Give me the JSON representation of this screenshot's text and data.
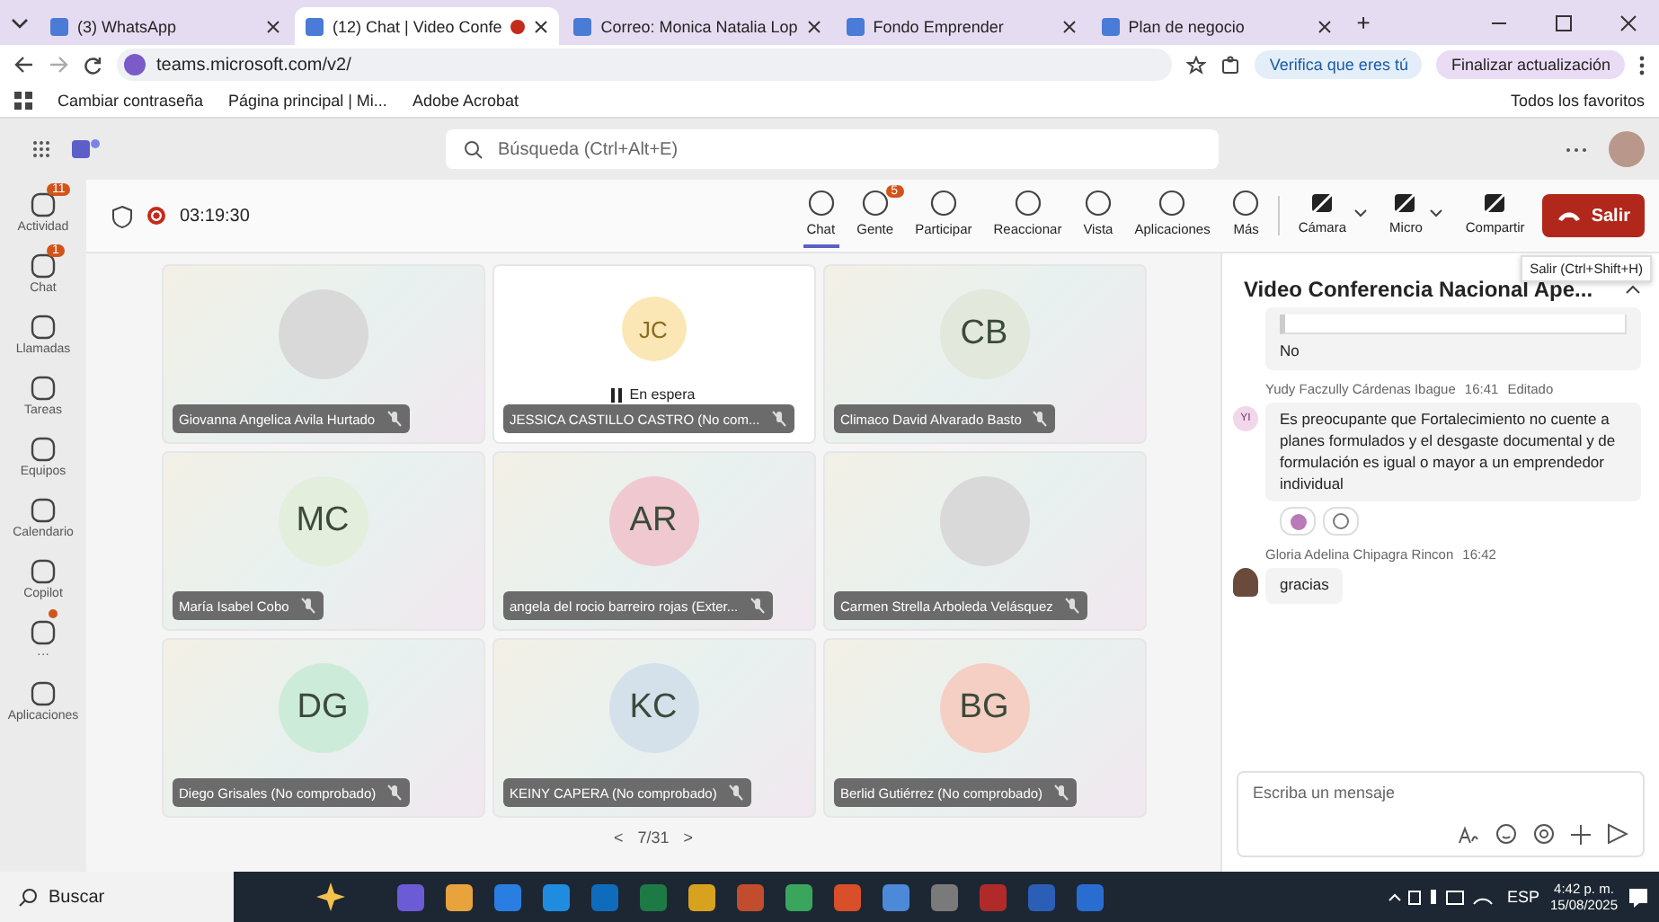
{
  "browser": {
    "tabs": [
      {
        "label": "(3) WhatsApp",
        "selected": false,
        "recording": false
      },
      {
        "label": "(12) Chat | Video Confe",
        "selected": true,
        "recording": true
      },
      {
        "label": "Correo: Monica Natalia Lop",
        "selected": false,
        "recording": false
      },
      {
        "label": "Fondo Emprender",
        "selected": false,
        "recording": false
      },
      {
        "label": "Plan de negocio",
        "selected": false,
        "recording": false
      }
    ],
    "new_tab": "+",
    "url": "teams.microsoft.com/v2/",
    "verify": "Verifica que eres tú",
    "update_button": "Finalizar actualización",
    "bookmarks": [
      "Cambiar contraseña",
      "Página principal | Mi...",
      "Adobe Acrobat"
    ],
    "favorites": "Todos los favoritos"
  },
  "teams": {
    "search": {
      "placeholder": "Búsqueda (Ctrl+Alt+E)"
    },
    "rail": [
      {
        "label": "Actividad",
        "badge": "11",
        "dot": false
      },
      {
        "label": "Chat",
        "badge": "1",
        "dot": false
      },
      {
        "label": "Llamadas",
        "dot": false
      },
      {
        "label": "Tareas",
        "dot": false
      },
      {
        "label": "Equipos",
        "dot": false
      },
      {
        "label": "Calendario",
        "dot": false
      },
      {
        "label": "Copilot",
        "dot": false
      },
      {
        "label": "···",
        "dot": true
      },
      {
        "label": "Aplicaciones",
        "dot": false
      }
    ],
    "meeting": {
      "timer": "03:19:30",
      "tools": [
        {
          "label": "Chat",
          "selected": true
        },
        {
          "label": "Gente",
          "selected": false,
          "badge": "5"
        },
        {
          "label": "Participar",
          "selected": false
        },
        {
          "label": "Reaccionar",
          "selected": false
        },
        {
          "label": "Vista",
          "selected": false
        },
        {
          "label": "Aplicaciones",
          "selected": false
        },
        {
          "label": "Más",
          "selected": false
        }
      ],
      "devices": [
        {
          "label": "Cámara",
          "caret": true
        },
        {
          "label": "Micro",
          "caret": true
        },
        {
          "label": "Compartir",
          "caret": false
        }
      ],
      "leave_button": "Salir",
      "tooltip": "Salir (Ctrl+Shift+H)"
    },
    "tiles": [
      {
        "kind": "photo",
        "name": "Giovanna Angelica Avila Hurtado",
        "color": "#d9d9d9",
        "on_hold": false
      },
      {
        "kind": "initials",
        "name": "JESSICA CASTILLO CASTRO (No com...",
        "initials": "JC",
        "color": "#fbe7b5",
        "on_hold": true,
        "status": "En espera"
      },
      {
        "kind": "initials",
        "name": "Climaco David Alvarado Basto",
        "initials": "CB",
        "color": "#e2e8dc",
        "on_hold": false
      },
      {
        "kind": "initials",
        "name": "María Isabel Cobo",
        "initials": "MC",
        "color": "#e3efdc",
        "on_hold": false
      },
      {
        "kind": "initials",
        "name": "angela del rocio barreiro rojas (Exter...",
        "initials": "AR",
        "color": "#efc9cf",
        "on_hold": false
      },
      {
        "kind": "photo",
        "name": "Carmen Strella Arboleda Velásquez",
        "color": "#d9d9d9",
        "on_hold": false
      },
      {
        "kind": "initials",
        "name": "Diego Grisales (No comprobado)",
        "initials": "DG",
        "color": "#cdebd9",
        "on_hold": false
      },
      {
        "kind": "initials",
        "name": "KEINY CAPERA (No comprobado)",
        "initials": "KC",
        "color": "#d5e1ea",
        "on_hold": false
      },
      {
        "kind": "initials",
        "name": "Berlid Gutiérrez (No comprobado)",
        "initials": "BG",
        "color": "#f5cfc4",
        "on_hold": false
      }
    ],
    "pager": {
      "prev": "<",
      "page": "7/31",
      "next": ">"
    },
    "chat": {
      "title": "Video Conferencia Nacional Ape...",
      "messages": [
        {
          "kind": "reply",
          "text": "No"
        },
        {
          "kind": "initials",
          "author": "Yudy Faczully Cárdenas Ibague",
          "time": "16:41",
          "edited": "Editado",
          "avatar": "YI",
          "text": "Es preocupante que Fortalecimiento no cuente a planes formulados y el desgaste documental y de formulación es igual o mayor a un emprendedor individual"
        },
        {
          "kind": "photo",
          "author": "Gloria Adelina Chipagra Rincon",
          "time": "16:42",
          "text": "gracias"
        }
      ],
      "compose": {
        "placeholder": "Escriba un mensaje"
      }
    }
  },
  "taskbar": {
    "search": "Buscar",
    "language": "ESP",
    "time": "4:42 p. m.",
    "date": "15/08/2025"
  }
}
